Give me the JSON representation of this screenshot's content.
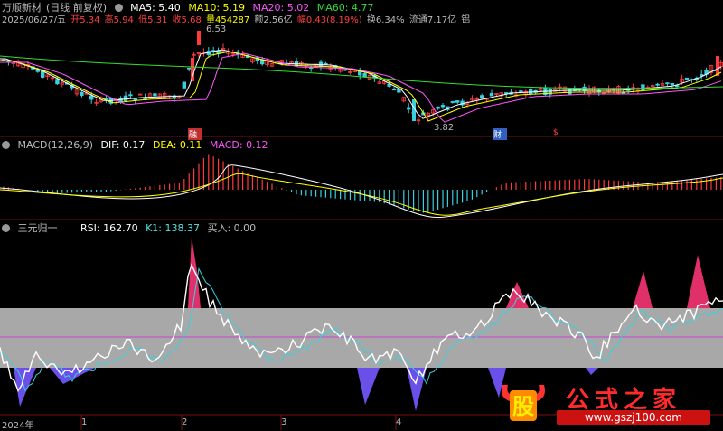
{
  "header": {
    "stock_name": "万顺新材",
    "mode": "(日线 前复权)",
    "ma5_label": "MA5: 5.40",
    "ma10_label": "MA10: 5.19",
    "ma20_label": "MA20: 5.02",
    "ma60_label": "MA60: 4.77"
  },
  "quote": {
    "date": "2025/06/27/五",
    "open": "开5.34",
    "high": "高5.94",
    "low": "低5.31",
    "close": "收5.68",
    "volume": "量454287",
    "amount": "额2.56亿",
    "change": "幅0.43(8.19%)",
    "turnover": "换6.34%",
    "float_cap": "流通7.17亿",
    "extra": "铝"
  },
  "price_annotations": {
    "high_mark": "6.53",
    "low_mark": "3.82"
  },
  "event_markers": [
    "融",
    "财",
    "$"
  ],
  "macd_panel": {
    "title": "MACD(12,26,9)",
    "dif": "DIF: 0.17",
    "dea": "DEA: 0.11",
    "macd": "MACD: 0.12"
  },
  "indicator_panel": {
    "title": "三元归一",
    "rsi": "RSI: 162.70",
    "k1": "K1: 138.37",
    "buy": "买入: 0.00"
  },
  "x_axis": [
    "2024年",
    "1",
    "2",
    "3",
    "4"
  ],
  "watermark": {
    "title": "公式之家",
    "url": "www.gszj100.com",
    "logo_char": "股"
  },
  "colors": {
    "up": "#ff3a3a",
    "down": "#38d0e0",
    "ma5": "#ffffff",
    "ma10": "#ffff00",
    "ma20": "#ff55ff",
    "ma60": "#33dd33",
    "rsi_fill_high": "#e0306a",
    "rsi_fill_low": "#6a50e8",
    "band": "#a8a8a8"
  }
}
